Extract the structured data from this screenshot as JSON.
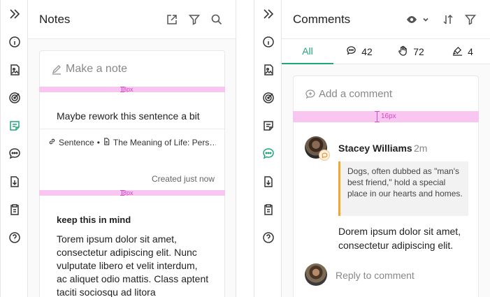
{
  "colors": {
    "accent": "#21a67a",
    "spacer": "#f8c6f0",
    "quote_border": "#f0a830"
  },
  "left_rail": {
    "icons": [
      "expand-icon",
      "info-icon",
      "image-icon",
      "target-icon",
      "notes-icon",
      "comments-icon",
      "download-icon",
      "clipboard-icon",
      "help-icon"
    ],
    "active": "notes-icon"
  },
  "right_rail": {
    "icons": [
      "expand-icon",
      "info-icon",
      "image-icon",
      "target-icon",
      "notes-icon",
      "comments-icon",
      "download-icon",
      "clipboard-icon",
      "help-icon"
    ],
    "active": "comments-icon"
  },
  "notes": {
    "title": "Notes",
    "header_icons": [
      "export-icon",
      "filter-icon",
      "search-icon"
    ],
    "make_note_placeholder": "Make a note",
    "spacer_label": "8px",
    "note1": {
      "body": "Maybe rework this sentence a bit",
      "link_label": "Sentence",
      "separator": "•",
      "doc_label": "The Meaning of Life: Pers…",
      "created": "Created just now"
    },
    "note2": {
      "title": "keep this in mind",
      "text": "Torem ipsum dolor sit amet, consectetur adipiscing elit. Nunc vulputate libero et velit interdum, ac aliquet odio mattis. Class aptent taciti sociosqu ad litora"
    }
  },
  "comments": {
    "title": "Comments",
    "header_icons": [
      "eye-icon",
      "chevron-down-icon",
      "sort-icon",
      "filter-icon"
    ],
    "tabs": [
      {
        "label": "All",
        "icon": ""
      },
      {
        "label": "42",
        "icon": "comment-icon"
      },
      {
        "label": "72",
        "icon": "hand-icon"
      },
      {
        "label": "4",
        "icon": "highlighter-icon"
      }
    ],
    "add_placeholder": "Add a comment",
    "spacer_label": "16px",
    "comment": {
      "author": "Stacey Williams",
      "ago": "2m",
      "quote": "Dogs, often dubbed as \"man's best friend,\" hold a special place in our hearts and homes.",
      "text": "Dorem ipsum dolor sit amet, consectetur adipiscing elit.",
      "reply_placeholder": "Reply to comment"
    }
  }
}
